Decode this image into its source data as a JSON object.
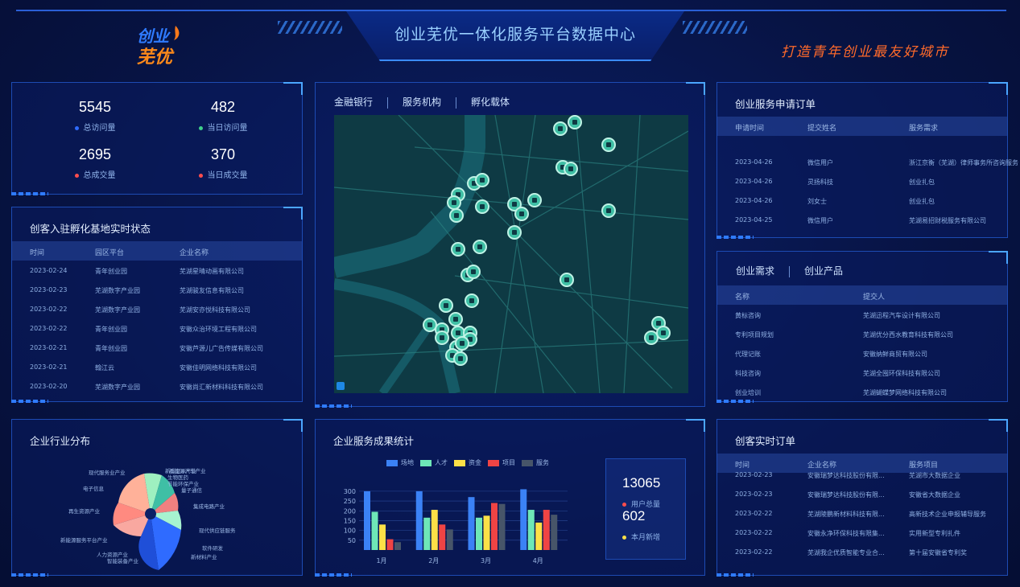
{
  "header": {
    "title": "创业芜优一体化服务平台数据中心",
    "slogan": "打造青年创业最友好城市",
    "logo_text_top": "创业",
    "logo_text_bottom": "芜优"
  },
  "stats": [
    {
      "value": "5545",
      "label": "总访问量",
      "color": "#2f6bff"
    },
    {
      "value": "482",
      "label": "当日访问量",
      "color": "#3fd08a"
    },
    {
      "value": "2695",
      "label": "总成交量",
      "color": "#ff4d4d"
    },
    {
      "value": "370",
      "label": "当日成交量",
      "color": "#ff4d4d"
    }
  ],
  "incubator": {
    "title": "创客入驻孵化基地实时状态",
    "columns": [
      "时间",
      "园区平台",
      "企业名称"
    ],
    "rows": [
      [
        "2023-02-24",
        "青年创业园",
        "芜湖星晴动画有限公司"
      ],
      [
        "2023-02-23",
        "芜湖数字产业园",
        "芜湖骏友信息有限公司"
      ],
      [
        "2023-02-22",
        "芜湖数字产业园",
        "芜湖安亦悦科技有限公司"
      ],
      [
        "2023-02-22",
        "青年创业园",
        "安徽众治环境工程有限公司"
      ],
      [
        "2023-02-21",
        "青年创业园",
        "安徽芦源儿广告传媒有限公司"
      ],
      [
        "2023-02-21",
        "翰江云",
        "安徽佳明网络科技有限公司"
      ],
      [
        "2023-02-20",
        "芜湖数字产业园",
        "安徽尚汇新材料科技有限公司"
      ]
    ]
  },
  "map_panel": {
    "tabs": [
      "金融银行",
      "服务机构",
      "孵化载体"
    ]
  },
  "orders": {
    "title": "创业服务申请订单",
    "columns": [
      "申请时间",
      "提交姓名",
      "服务需求"
    ],
    "rows": [
      [
        "2023-04-26",
        "微信用户",
        "浙江京衡（芜湖）律师事务所咨询服务"
      ],
      [
        "2023-04-26",
        "灵扬科技",
        "创业扎包"
      ],
      [
        "2023-04-26",
        "刘女士",
        "创业扎包"
      ],
      [
        "2023-04-25",
        "微信用户",
        "芜湖易招财税服务有限公司"
      ]
    ]
  },
  "demand": {
    "tabs": [
      "创业需求",
      "创业产品"
    ],
    "columns": [
      "名称",
      "提交人"
    ],
    "rows": [
      [
        "黄标咨询",
        "芜湖迅程汽车设计有限公司"
      ],
      [
        "专利项目规划",
        "芜湖优分西水教育科技有限公司"
      ],
      [
        "代理记账",
        "安徽纳鲜商贸有限公司"
      ],
      [
        "科技咨询",
        "芜湖全囤环保科技有限公司"
      ],
      [
        "创业培训",
        "芜湖蝴蝶梦网络科技有限公司"
      ]
    ]
  },
  "industry": {
    "title": "企业行业分布",
    "labels": [
      "现代服务业产业",
      "新能源汽车产业",
      "生物医药",
      "节能环保产业",
      "量子通信",
      "集成电路产业",
      "电子信息",
      "现代供应链服务",
      "软件研发",
      "新材料产业",
      "智能装备产业",
      "人力资源产业",
      "新能源服务平台产业",
      "再生资源产业",
      "新型显示产业"
    ]
  },
  "service_stats": {
    "title": "企业服务成果统计",
    "legend": [
      {
        "name": "场地",
        "color": "#3b82f6"
      },
      {
        "name": "人才",
        "color": "#6ee7b7"
      },
      {
        "name": "资金",
        "color": "#fde047"
      },
      {
        "name": "项目",
        "color": "#ef4444"
      },
      {
        "name": "服务",
        "color": "#475569"
      }
    ],
    "kpi": {
      "total_users": "13065",
      "total_users_label": "用户总量",
      "month_new": "602",
      "month_new_label": "本月新增"
    }
  },
  "chart_data": {
    "type": "bar",
    "categories": [
      "1月",
      "2月",
      "3月",
      "4月"
    ],
    "ylim": [
      0,
      320
    ],
    "yticks": [
      50,
      100,
      150,
      200,
      250,
      300
    ],
    "series": [
      {
        "name": "场地",
        "values": [
          300,
          300,
          270,
          310
        ]
      },
      {
        "name": "人才",
        "values": [
          195,
          165,
          165,
          205
        ]
      },
      {
        "name": "资金",
        "values": [
          130,
          205,
          175,
          140
        ]
      },
      {
        "name": "项目",
        "values": [
          55,
          130,
          240,
          205
        ]
      },
      {
        "name": "服务",
        "values": [
          40,
          105,
          235,
          180
        ]
      }
    ]
  },
  "realtime": {
    "title": "创客实时订单",
    "columns": [
      "时间",
      "企业名称",
      "服务项目"
    ],
    "rows": [
      [
        "2023-02-23",
        "安徽瑞梦达科技股份有限...",
        "芜湖市大数据企业"
      ],
      [
        "2023-02-23",
        "安徽瑞梦达科技股份有限...",
        "安徽省大数据企业"
      ],
      [
        "2023-02-22",
        "芜湖陵鹏新材料科技有限...",
        "高新技术企业申报辅导服务"
      ],
      [
        "2023-02-22",
        "安徽永净环保科技有限集...",
        "实用新型专利扎件"
      ],
      [
        "2023-02-22",
        "芜湖我企优质智能专业合...",
        "第十届安徽省专利奖"
      ]
    ]
  }
}
